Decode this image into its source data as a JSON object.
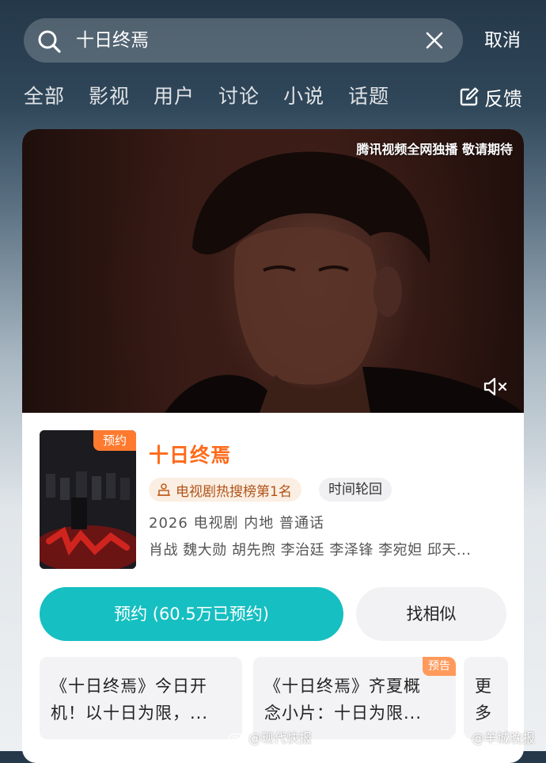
{
  "search": {
    "query": "十日终焉",
    "cancel_label": "取消"
  },
  "tabs": [
    {
      "label": "全部"
    },
    {
      "label": "影视"
    },
    {
      "label": "用户"
    },
    {
      "label": "讨论"
    },
    {
      "label": "小说"
    },
    {
      "label": "话题"
    }
  ],
  "feedback": {
    "label": "反馈",
    "icon": "edit-icon"
  },
  "banner": {
    "caption": "腾讯视频全网独播 敬请期待",
    "mute_icon": "speaker-muted-icon"
  },
  "show": {
    "poster_badge": "预约",
    "title": "十日终焉",
    "rank_tag": "电视剧热搜榜第1名",
    "theme_tag": "时间轮回",
    "meta": "2026 电视剧 内地 普通话",
    "cast": "肖战 魏大勋 胡先煦 李治廷 李泽锋 李宛妲 邱天..."
  },
  "actions": {
    "reserve_label": "预约 (60.5万已预约)",
    "similar_label": "找相似"
  },
  "news": [
    {
      "line1": "《十日终焉》今日开",
      "line2": "机！以十日为限，...",
      "badge": ""
    },
    {
      "line1": "《十日终焉》齐夏概",
      "line2": "念小片：十日为限...",
      "badge": "预告"
    },
    {
      "line1": "更",
      "line2": "多",
      "badge": ""
    }
  ],
  "watermarks": [
    "@现代快报",
    "@羊城晚报"
  ],
  "colors": {
    "accent_orange": "#ff6a1a",
    "reserve_teal": "#16bfc1"
  }
}
